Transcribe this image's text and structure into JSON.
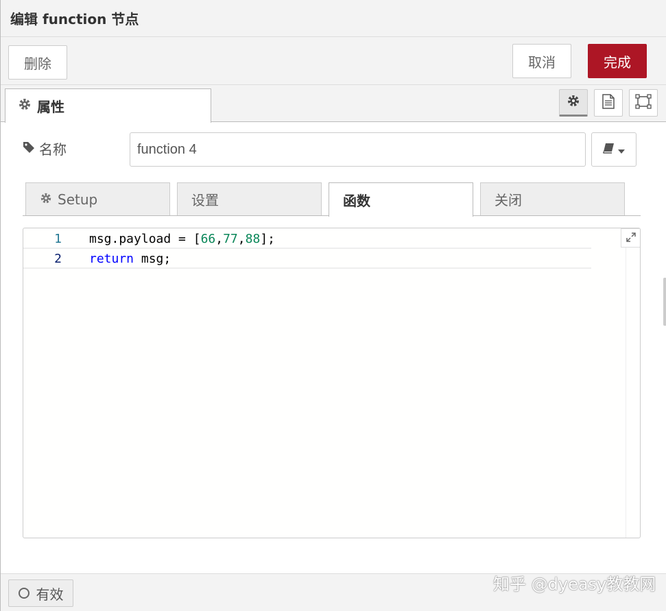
{
  "dialog": {
    "title": "编辑 function 节点"
  },
  "toolbar": {
    "delete_label": "删除",
    "cancel_label": "取消",
    "done_label": "完成"
  },
  "tabs": {
    "properties_label": "属性"
  },
  "name_field": {
    "label": "名称",
    "value": "function 4"
  },
  "subtabs": [
    {
      "label": "Setup"
    },
    {
      "label": "设置"
    },
    {
      "label": "函数"
    },
    {
      "label": "关闭"
    }
  ],
  "editor": {
    "lines": [
      {
        "num": "1",
        "code": "msg.payload = [66,77,88];"
      },
      {
        "num": "2",
        "code": "return msg;"
      }
    ]
  },
  "footer": {
    "enabled_label": "有效"
  },
  "watermark": "知乎 @dyeasy教教网"
}
